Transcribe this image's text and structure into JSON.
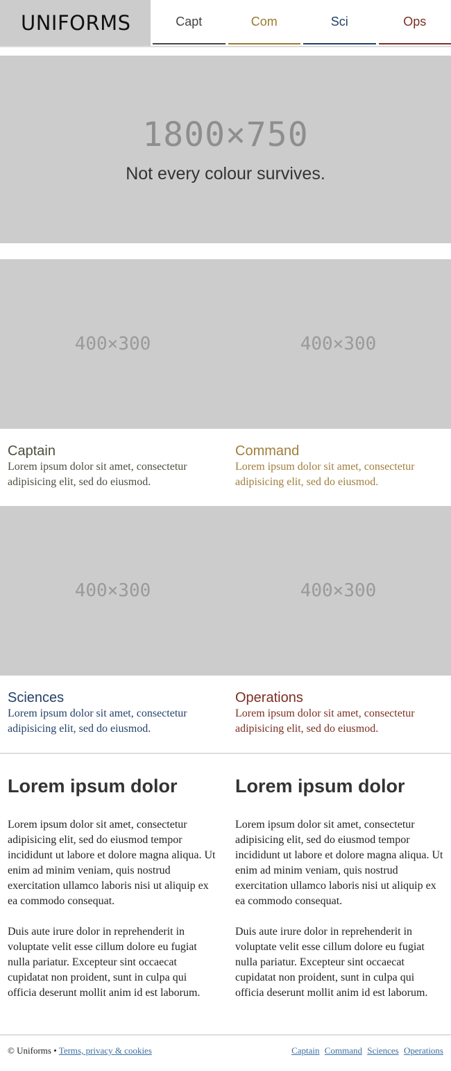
{
  "header": {
    "logo": "UNIFORMS",
    "nav": [
      {
        "label": "Capt",
        "color": "#444444"
      },
      {
        "label": "Com",
        "color": "#9b7a2e"
      },
      {
        "label": "Sci",
        "color": "#24406a"
      },
      {
        "label": "Ops",
        "color": "#7a2f22"
      }
    ]
  },
  "hero": {
    "size_label": "1800×750",
    "caption": "Not every colour survives."
  },
  "cards": [
    {
      "image_label": "400×300",
      "title": "Captain",
      "desc": "Lorem ipsum dolor sit amet, consectetur adipisicing elit, sed do eiusmod.",
      "color": "#4d4d3f"
    },
    {
      "image_label": "400×300",
      "title": "Command",
      "desc": "Lorem ipsum dolor sit amet, consectetur adipisicing elit, sed do eiusmod.",
      "color": "#a07e3c"
    },
    {
      "image_label": "400×300",
      "title": "Sciences",
      "desc": "Lorem ipsum dolor sit amet, consectetur adipisicing elit, sed do eiusmod.",
      "color": "#24406a"
    },
    {
      "image_label": "400×300",
      "title": "Operations",
      "desc": "Lorem ipsum dolor sit amet, consectetur adipisicing elit, sed do eiusmod.",
      "color": "#7a2f22"
    }
  ],
  "articles": [
    {
      "title": "Lorem ipsum dolor",
      "p1": "Lorem ipsum dolor sit amet, consectetur adipisicing elit, sed do eiusmod tempor incididunt ut labore et dolore magna aliqua. Ut enim ad minim veniam, quis nostrud exercitation ullamco laboris nisi ut aliquip ex ea commodo consequat.",
      "p2": "Duis aute irure dolor in reprehenderit in voluptate velit esse cillum dolore eu fugiat nulla pariatur. Excepteur sint occaecat cupidatat non proident, sunt in culpa qui officia deserunt mollit anim id est laborum."
    },
    {
      "title": "Lorem ipsum dolor",
      "p1": "Lorem ipsum dolor sit amet, consectetur adipisicing elit, sed do eiusmod tempor incididunt ut labore et dolore magna aliqua. Ut enim ad minim veniam, quis nostrud exercitation ullamco laboris nisi ut aliquip ex ea commodo consequat.",
      "p2": "Duis aute irure dolor in reprehenderit in voluptate velit esse cillum dolore eu fugiat nulla pariatur. Excepteur sint occaecat cupidatat non proident, sunt in culpa qui officia deserunt mollit anim id est laborum."
    }
  ],
  "footer": {
    "copyright": "© Uniforms •",
    "terms_link": "Terms, privacy & cookies",
    "links": [
      "Captain",
      "Command",
      "Sciences",
      "Operations"
    ]
  }
}
